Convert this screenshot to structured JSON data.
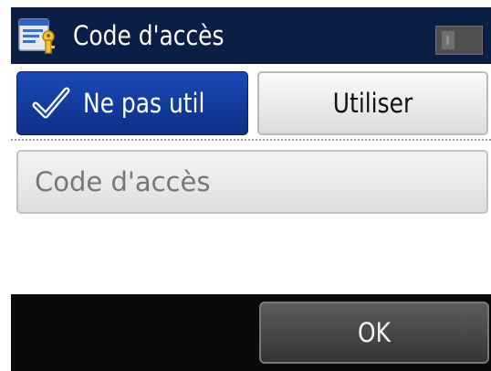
{
  "header": {
    "title": "Code d'accès",
    "icon": "password-settings-icon",
    "help_icon": "help-icon"
  },
  "toggle": {
    "off_label": "Ne pas util",
    "off_icon": "checkmark-icon",
    "on_label": "Utiliser",
    "selected": "off"
  },
  "code_field": {
    "placeholder": "Code d'accès",
    "value": ""
  },
  "footer": {
    "ok_label": "OK"
  },
  "colors": {
    "header_bg": "#0b1e45",
    "selected_button": "#1b49b8",
    "footer_bg": "#0a0a0a"
  }
}
